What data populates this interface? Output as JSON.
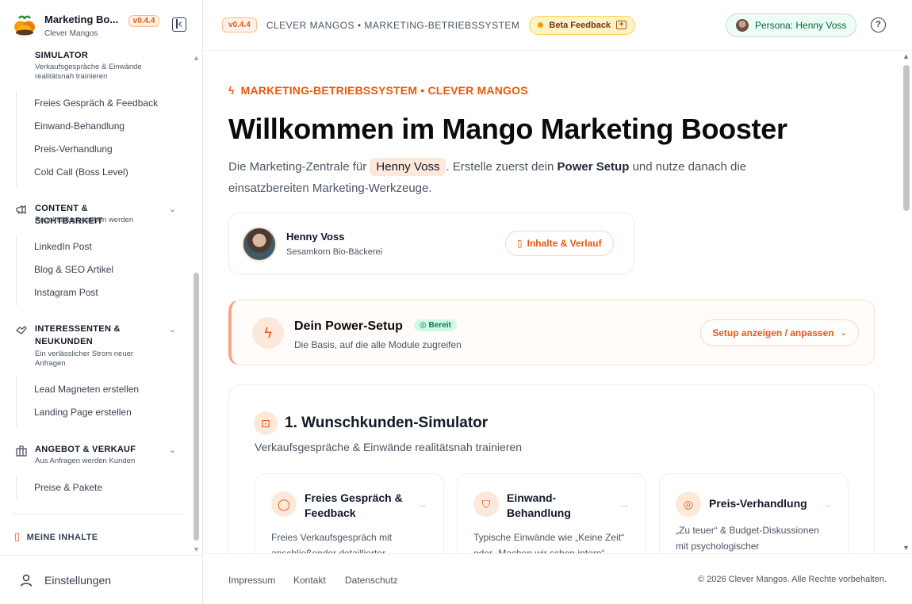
{
  "sidebar": {
    "app_title": "Marketing Bo...",
    "app_subtitle": "Clever Mangos",
    "version": "v0.4.4",
    "simulator": {
      "title": "SIMULATOR",
      "desc": "Verkaufsgespräche & Einwände realitätsnah trainieren",
      "items": [
        "Freies Gespräch & Feedback",
        "Einwand-Behandlung",
        "Preis-Verhandlung",
        "Cold Call (Boss Level)"
      ]
    },
    "content": {
      "title": "CONTENT & SICHTBARKEIT",
      "desc": "Regelmäßig gesehen werden",
      "icon": "megaphone-icon",
      "items": [
        "LinkedIn Post",
        "Blog & SEO Artikel",
        "Instagram Post"
      ]
    },
    "leads": {
      "title": "INTERESSENTEN & NEUKUNDEN",
      "desc": "Ein verlässlicher Strom neuer Anfragen",
      "icon": "handshake-icon",
      "items": [
        "Lead Magneten erstellen",
        "Landing Page erstellen"
      ]
    },
    "offer": {
      "title": "ANGEBOT & VERKAUF",
      "desc": "Aus Anfragen werden Kunden",
      "icon": "shop-icon",
      "items": [
        "Preise & Pakete"
      ]
    },
    "my_content": "MEINE INHALTE",
    "settings": "Einstellungen"
  },
  "topbar": {
    "version": "v0.4.4",
    "brand": "CLEVER MANGOS • MARKETING-BETRIEBSSYSTEM",
    "beta": "Beta Feedback",
    "persona": "Persona: Henny Voss",
    "help": "?"
  },
  "main": {
    "eyebrow": "MARKETING-BETRIEBSSYSTEM • CLEVER MANGOS",
    "title": "Willkommen im Mango Marketing Booster",
    "lead_1": "Die Marketing-Zentrale für",
    "lead_name": "Henny Voss",
    "lead_2": ". Erstelle zuerst dein",
    "lead_bold": "Power Setup",
    "lead_3": "und nutze danach die einsatzbereiten Marketing-Werkzeuge.",
    "profile": {
      "name": "Henny Voss",
      "company": "Sesamkorn Bio-Bäckerei",
      "button": "Inhalte & Verlauf"
    },
    "power": {
      "title": "Dein Power-Setup",
      "badge": "Bereit",
      "subtitle": "Die Basis, auf die alle Module zugreifen",
      "button": "Setup anzeigen / anpassen"
    },
    "simulator": {
      "title": "1. Wunschkunden-Simulator",
      "subtitle": "Verkaufsgespräche & Einwände realitätsnah trainieren",
      "cards": [
        {
          "title": "Freies Gespräch & Feedback",
          "desc": "Freies Verkaufsgespräch mit anschließender detaillierter",
          "icon": "chat-bubble-icon"
        },
        {
          "title": "Einwand-Behandlung",
          "desc": "Typische Einwände wie „Keine Zeit“ oder „Machen wir schon intern“",
          "icon": "shield-icon"
        },
        {
          "title": "Preis-Verhandlung",
          "desc": "„Zu teuer“ & Budget-Diskussionen mit psychologischer",
          "icon": "coins-icon"
        }
      ]
    }
  },
  "footer": {
    "links": [
      "Impressum",
      "Kontakt",
      "Datenschutz"
    ],
    "copyright": "© 2026 Clever Mangos. Alle Rechte vorbehalten."
  },
  "colors": {
    "accent": "#ea580c",
    "accent_soft": "#fde8dc",
    "ready_green": "#047857"
  }
}
